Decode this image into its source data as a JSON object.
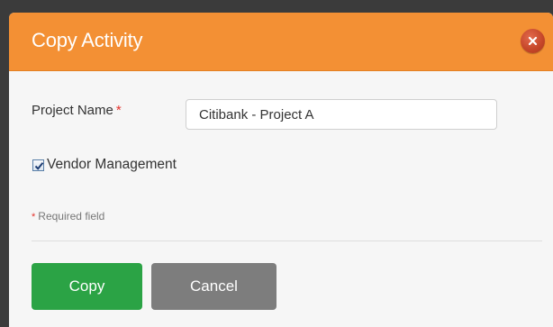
{
  "dialog": {
    "title": "Copy Activity",
    "close_icon": "close-icon",
    "colors": {
      "titlebar": "#f39034",
      "close": "#c44528",
      "copy_button": "#2ba345",
      "cancel_button": "#7d7d7d",
      "required": "#e4322c"
    }
  },
  "form": {
    "project_name_label": "Project Name",
    "required_marker": "*",
    "project_name_value": "Citibank - Project A",
    "vendor_management_label": "Vendor Management",
    "vendor_management_checked": true,
    "required_note": "Required field"
  },
  "actions": {
    "copy_label": "Copy",
    "cancel_label": "Cancel"
  }
}
